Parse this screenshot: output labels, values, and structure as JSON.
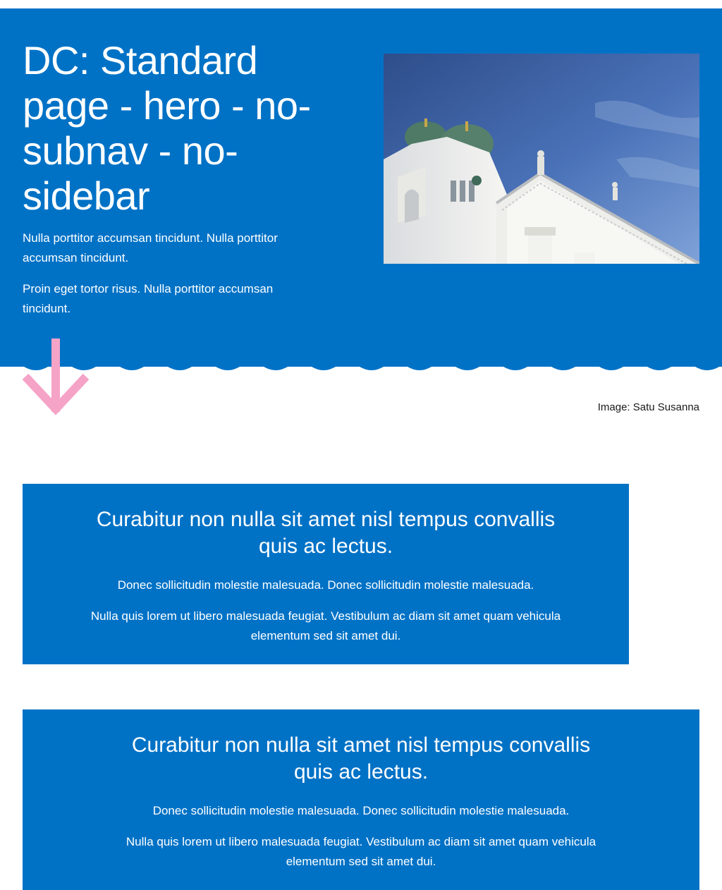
{
  "hero": {
    "title": "DC: Standard page - hero - no-subnav - no-sidebar",
    "paragraph_1": "Nulla porttitor accumsan tincidunt. Nulla porttitor accumsan tincidunt.",
    "paragraph_2": "Proin eget tortor risus. Nulla porttitor accumsan tincidunt.",
    "background_color": "#0072c6",
    "image_caption": "Image: Satu Susanna"
  },
  "arrow": {
    "color": "#f5a3c7",
    "icon": "arrow-down-icon"
  },
  "banners": [
    {
      "title": "Curabitur non nulla sit amet nisl tempus convallis quis ac lectus.",
      "text_1": "Donec sollicitudin molestie malesuada. Donec sollicitudin molestie malesuada.",
      "text_2": "Nulla quis lorem ut libero malesuada feugiat. Vestibulum ac diam sit amet quam vehicula elementum sed sit amet dui."
    },
    {
      "title": "Curabitur non nulla sit amet nisl tempus convallis quis ac lectus.",
      "text_1": "Donec sollicitudin molestie malesuada. Donec sollicitudin molestie malesuada.",
      "text_2": "Nulla quis lorem ut libero malesuada feugiat. Vestibulum ac diam sit amet quam vehicula elementum sed sit amet dui."
    }
  ]
}
